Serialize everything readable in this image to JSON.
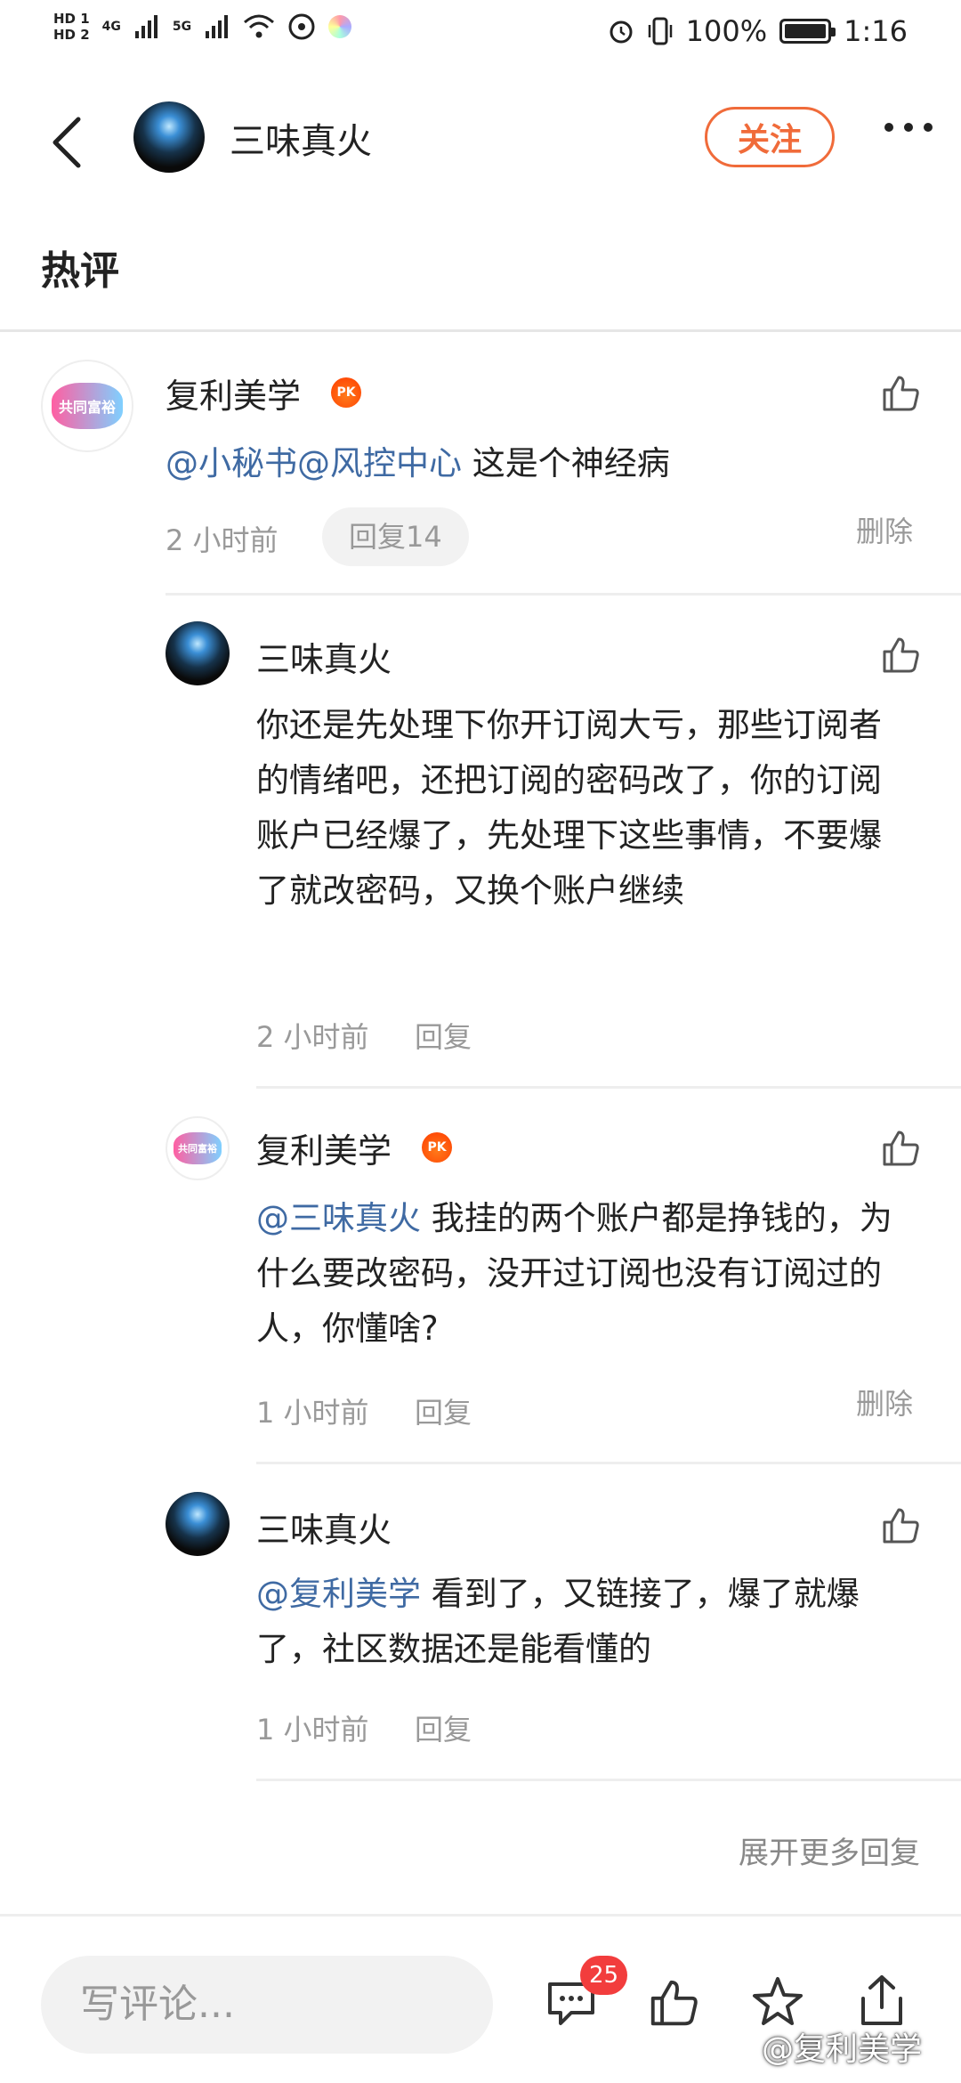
{
  "status_bar": {
    "hd1": "HD 1",
    "hd2": "HD 2",
    "net1": "4G",
    "net2": "5G",
    "battery_percent": "100%",
    "battery_level": 1.0,
    "time": "1:16"
  },
  "header": {
    "user_name": "三味真火",
    "follow_label": "关注"
  },
  "section_title": "热评",
  "comments": {
    "main": {
      "author": "复利美学",
      "avatar_text": "共同富裕",
      "badge": "PK",
      "mention": "@小秘书@风控中心",
      "text": " 这是个神经病",
      "time": "2 小时前",
      "reply_label": "回复14",
      "delete_label": "删除"
    },
    "replies": [
      {
        "author": "三味真火",
        "text": "你还是先处理下你开订阅大亏，那些订阅者的情绪吧，还把订阅的密码改了，你的订阅账户已经爆了，先处理下这些事情，不要爆了就改密码，又换个账户继续",
        "time": "2 小时前",
        "reply_label": "回复"
      },
      {
        "author": "复利美学",
        "avatar_text": "共同富裕",
        "badge": "PK",
        "mention": "@三味真火",
        "text": " 我挂的两个账户都是挣钱的，为什么要改密码，没开过订阅也没有订阅过的人，你懂啥?",
        "time": "1 小时前",
        "reply_label": "回复",
        "delete_label": "删除"
      },
      {
        "author": "三味真火",
        "mention": "@复利美学",
        "text": " 看到了，又链接了，爆了就爆了，社区数据还是能看懂的",
        "time": "1 小时前",
        "reply_label": "回复"
      }
    ],
    "expand_more": "展开更多回复"
  },
  "bottom_bar": {
    "input_placeholder": "写评论...",
    "comment_count": "25",
    "watermark": "@复利美学"
  },
  "colors": {
    "accent": "#f06b3a",
    "mention": "#3f6aa3",
    "badge_red": "#f23d3d"
  },
  "icons": [
    "back-arrow-icon",
    "more-icon",
    "like-icon",
    "pk-badge-icon",
    "comment-icon",
    "share-icon",
    "star-icon",
    "signal-icon",
    "wifi-icon",
    "alarm-icon",
    "vibrate-icon",
    "battery-icon"
  ]
}
